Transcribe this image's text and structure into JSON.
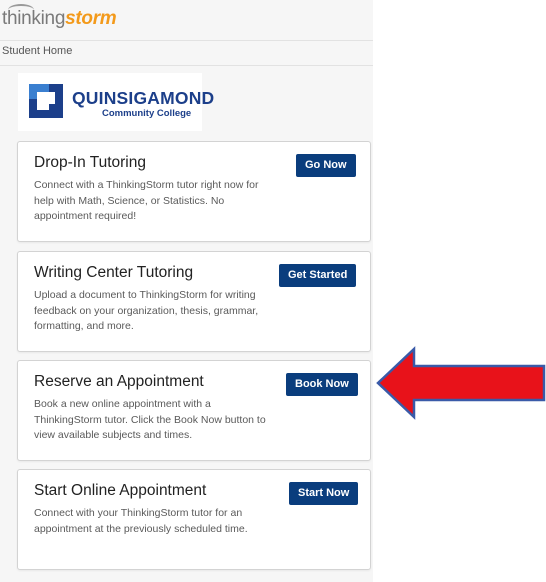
{
  "header": {
    "logo_part1": "thinking",
    "logo_part2": "storm",
    "breadcrumb": "Student Home"
  },
  "school": {
    "name": "QUINSIGAMOND",
    "subtitle": "Community College"
  },
  "cards": [
    {
      "title": "Drop-In Tutoring",
      "description": "Connect with a ThinkingStorm tutor right now for help with Math, Science, or Statistics. No appointment required!",
      "button": "Go Now"
    },
    {
      "title": "Writing Center Tutoring",
      "description": "Upload a document to ThinkingStorm for writing feedback on your organization, thesis, grammar, formatting, and more.",
      "button": "Get Started"
    },
    {
      "title": "Reserve an Appointment",
      "description": "Book a new online appointment with a ThinkingStorm tutor. Click the Book Now button to view available subjects and times.",
      "button": "Book Now"
    },
    {
      "title": "Start Online Appointment",
      "description": "Connect with your ThinkingStorm tutor for an appointment at the previously scheduled time.",
      "button": "Start Now"
    }
  ],
  "colors": {
    "brand_orange": "#f39a1b",
    "button_navy": "#0a3d7d",
    "school_blue": "#1c3f8a",
    "arrow_red": "#e8121a",
    "arrow_outline": "#3a5aa8"
  }
}
